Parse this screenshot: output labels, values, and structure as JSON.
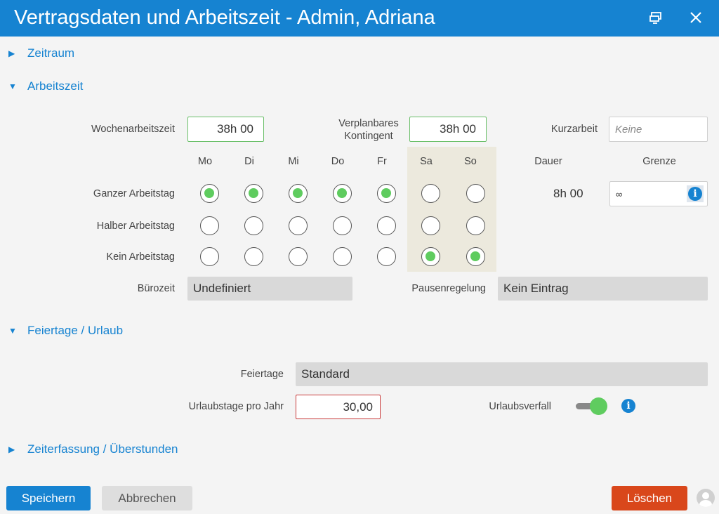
{
  "window": {
    "title": "Vertragsdaten und Arbeitszeit - Admin, Adriana",
    "icons": [
      "popout-icon",
      "close-icon"
    ]
  },
  "sections": {
    "zeitraum": "Zeitraum",
    "arbeitszeit": "Arbeitszeit",
    "feiertage_urlaub": "Feiertage / Urlaub",
    "zeiterfassung": "Zeiterfassung / Überstunden"
  },
  "arbeitszeit": {
    "wochenarbeitszeit_label": "Wochenarbeitszeit",
    "wochenarbeitszeit_value": "38h 00",
    "kontingent_label_1": "Verplanbares",
    "kontingent_label_2": "Kontingent",
    "kontingent_value": "38h 00",
    "kurzarbeit_label": "Kurzarbeit",
    "kurzarbeit_placeholder": "Keine",
    "days": [
      "Mo",
      "Di",
      "Mi",
      "Do",
      "Fr",
      "Sa",
      "So"
    ],
    "dauer_label": "Dauer",
    "grenze_label": "Grenze",
    "rows": [
      {
        "label": "Ganzer Arbeitstag",
        "selected": [
          true,
          true,
          true,
          true,
          true,
          false,
          false
        ]
      },
      {
        "label": "Halber Arbeitstag",
        "selected": [
          false,
          false,
          false,
          false,
          false,
          false,
          false
        ]
      },
      {
        "label": "Kein Arbeitstag",
        "selected": [
          false,
          false,
          false,
          false,
          false,
          true,
          true
        ]
      }
    ],
    "dauer_value": "8h 00",
    "grenze_value": "∞",
    "buerozeit_label": "Bürozeit",
    "buerozeit_value": "Undefiniert",
    "pausenregelung_label": "Pausenregelung",
    "pausenregelung_value": "Kein Eintrag"
  },
  "urlaub": {
    "feiertage_label": "Feiertage",
    "feiertage_value": "Standard",
    "urlaubstage_label": "Urlaubstage pro Jahr",
    "urlaubstage_value": "30,00",
    "urlaubsverfall_label": "Urlaubsverfall",
    "urlaubsverfall_on": true
  },
  "footer": {
    "save": "Speichern",
    "cancel": "Abbrechen",
    "delete": "Löschen"
  },
  "colors": {
    "accent": "#1683d1",
    "selected": "#5fcc5f",
    "delete": "#d9471b",
    "weekend_bg": "#ece9dd",
    "invalid_border": "#c93a3a"
  }
}
